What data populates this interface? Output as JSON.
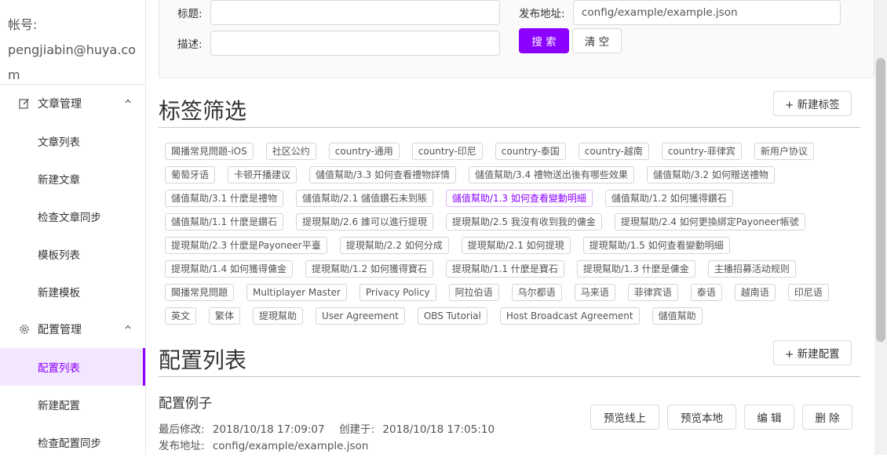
{
  "sidebar": {
    "account_label": "帐号:",
    "account_value": "pengjiabin@huya.com",
    "groups": [
      {
        "label": "文章管理",
        "icon": "edit-icon",
        "items": [
          "文章列表",
          "新建文章",
          "检查文章同步",
          "模板列表",
          "新建模板"
        ]
      },
      {
        "label": "配置管理",
        "icon": "gear-icon",
        "items": [
          "配置列表",
          "新建配置",
          "检查配置同步"
        ],
        "active_item": "配置列表"
      }
    ]
  },
  "search": {
    "title_label": "标题:",
    "title_value": "",
    "desc_label": "描述:",
    "desc_value": "",
    "url_label": "发布地址:",
    "url_value": "config/example/example.json",
    "search_button": "搜 索",
    "clear_button": "清 空"
  },
  "tags_section": {
    "title": "标签筛选",
    "new_button": "+ 新建标签",
    "active_tag": "儲值幫助/1.3 如何查看變動明細",
    "tags": [
      "閪播常見問題-iOS",
      "社区公约",
      "country-通用",
      "country-印尼",
      "country-泰国",
      "country-越南",
      "country-菲律宾",
      "新用户协议",
      "葡萄牙语",
      "卡顿开播建议",
      "儲值幫助/3.3 如何查看禮物詳情",
      "儲值幫助/3.4 禮物送出後有哪些效果",
      "儲值幫助/3.2 如何贈送禮物",
      "儲值幫助/3.1 什麼是禮物",
      "儲值幫助/2.1 儲值鑽石未到賬",
      "儲值幫助/1.3 如何查看變動明細",
      "儲值幫助/1.2 如何獲得鑽石",
      "儲值幫助/1.1 什麼是鑽石",
      "提現幫助/2.6 誰可以進行提現",
      "提現幫助/2.5 我沒有收到我的傭金",
      "提現幫助/2.4 如何更換綁定Payoneer帳號",
      "提現幫助/2.3 什麼是Payoneer平臺",
      "提現幫助/2.2 如何分成",
      "提現幫助/2.1 如何提現",
      "提現幫助/1.5 如何查看變動明細",
      "提現幫助/1.4 如何獲得傭金",
      "提現幫助/1.2 如何獲得寶石",
      "提現幫助/1.1 什麼是寶石",
      "提現幫助/1.3 什麼是傭金",
      "主播招募活动规则",
      "閪播常見問題",
      "Multiplayer Master",
      "Privacy Policy",
      "阿拉伯语",
      "乌尔都语",
      "马来语",
      "菲律宾语",
      "泰语",
      "越南语",
      "印尼语",
      "英文",
      "繁体",
      "提現幫助",
      "User Agreement",
      "OBS Tutorial",
      "Host Broadcast Agreement",
      "儲值幫助"
    ]
  },
  "config_section": {
    "title": "配置列表",
    "new_button": "+ 新建配置",
    "item": {
      "name": "配置例子",
      "modified_label": "最后修改:",
      "modified_value": "2018/10/18 17:09:07",
      "created_label": "创建于:",
      "created_value": "2018/10/18 17:05:10",
      "url_label": "发布地址:",
      "url_value": "config/example/example.json",
      "actions": [
        "预览线上",
        "预览本地",
        "编 辑",
        "删 除"
      ]
    }
  },
  "colors": {
    "accent": "#8b00ff",
    "active_bg": "#f3e6ff"
  }
}
